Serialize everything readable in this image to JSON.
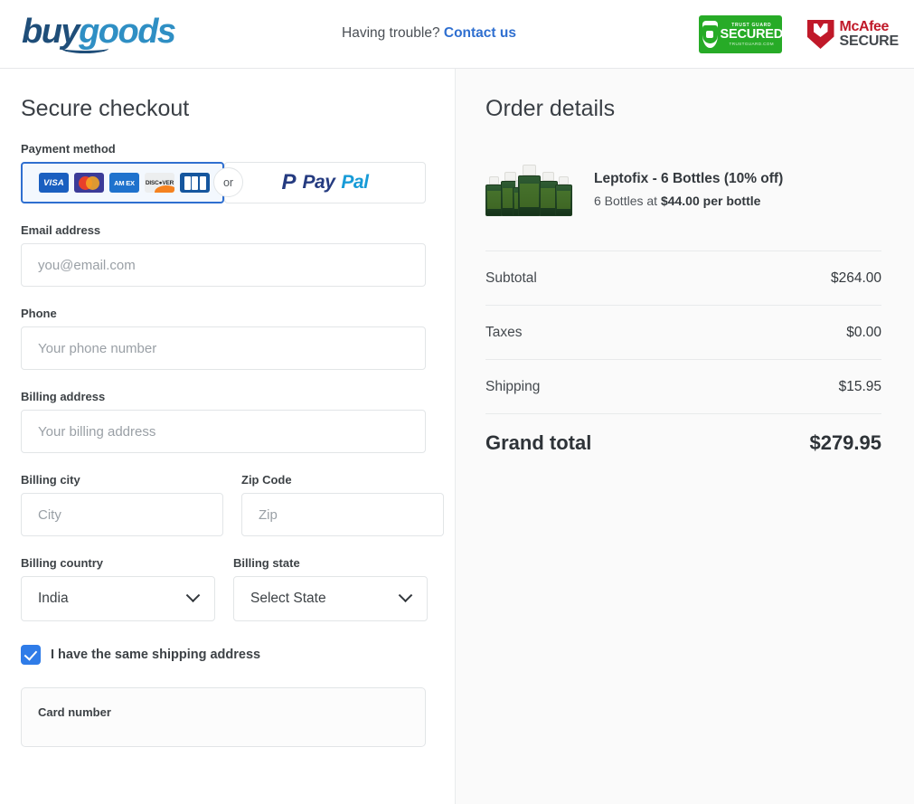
{
  "header": {
    "logo_part1": "buy",
    "logo_part2": "goods",
    "help_text": "Having trouble?",
    "contact_link": "Contact us",
    "badges": {
      "trustguard": {
        "top": "TRUST GUARD",
        "main": "SECURED",
        "bottom": "TRUSTGUARD.COM"
      },
      "mcafee": {
        "line1": "McAfee",
        "line2": "SECURE"
      }
    }
  },
  "checkout": {
    "title": "Secure checkout",
    "payment_method_label": "Payment method",
    "or_label": "or",
    "card_brands": [
      "VISA",
      "AM EX",
      "DISC VER",
      "JCB",
      "Mastercard"
    ],
    "paypal": {
      "part1": "Pay",
      "part2": "Pal"
    },
    "fields": {
      "email": {
        "label": "Email address",
        "placeholder": "you@email.com",
        "value": ""
      },
      "phone": {
        "label": "Phone",
        "placeholder": "Your phone number",
        "value": ""
      },
      "address": {
        "label": "Billing address",
        "placeholder": "Your billing address",
        "value": ""
      },
      "city": {
        "label": "Billing city",
        "placeholder": "City",
        "value": ""
      },
      "zip": {
        "label": "Zip Code",
        "placeholder": "Zip",
        "value": ""
      },
      "country": {
        "label": "Billing country",
        "value": "India"
      },
      "state": {
        "label": "Billing state",
        "value": "Select State"
      }
    },
    "same_shipping_label": "I have the same shipping address",
    "card_number_label": "Card number"
  },
  "order": {
    "title": "Order details",
    "product_name": "Leptofix - 6 Bottles (10% off)",
    "product_qty_text": "6 Bottles at ",
    "product_price_text": "$44.00 per bottle",
    "lines": [
      {
        "label": "Subtotal",
        "value": "$264.00"
      },
      {
        "label": "Taxes",
        "value": "$0.00"
      },
      {
        "label": "Shipping",
        "value": "$15.95"
      }
    ],
    "grand_total_label": "Grand total",
    "grand_total_value": "$279.95"
  },
  "colors": {
    "accent_blue": "#2f6fd0",
    "checkbox_blue": "#2f7ce8",
    "trustguard_green": "#27ab27",
    "mcafee_red": "#c01929"
  }
}
